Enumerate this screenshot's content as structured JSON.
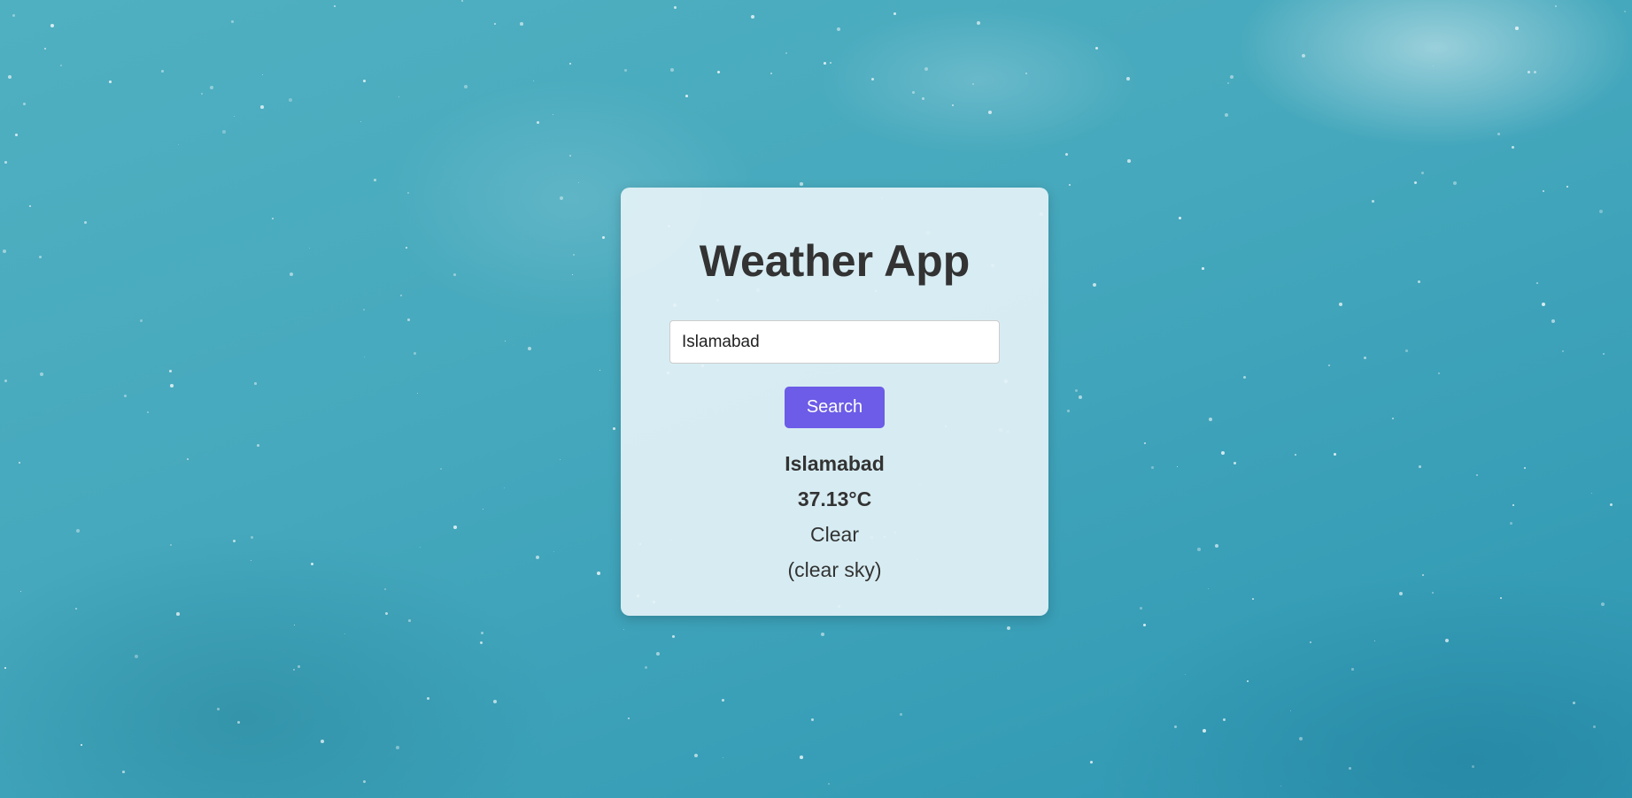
{
  "app": {
    "title": "Weather App"
  },
  "search": {
    "value": "Islamabad",
    "button_label": "Search"
  },
  "result": {
    "city": "Islamabad",
    "temperature": "37.13°C",
    "condition": "Clear",
    "description": "(clear sky)"
  },
  "colors": {
    "accent": "#6c5ce7",
    "text": "#333333",
    "background": "#47a9bd"
  }
}
